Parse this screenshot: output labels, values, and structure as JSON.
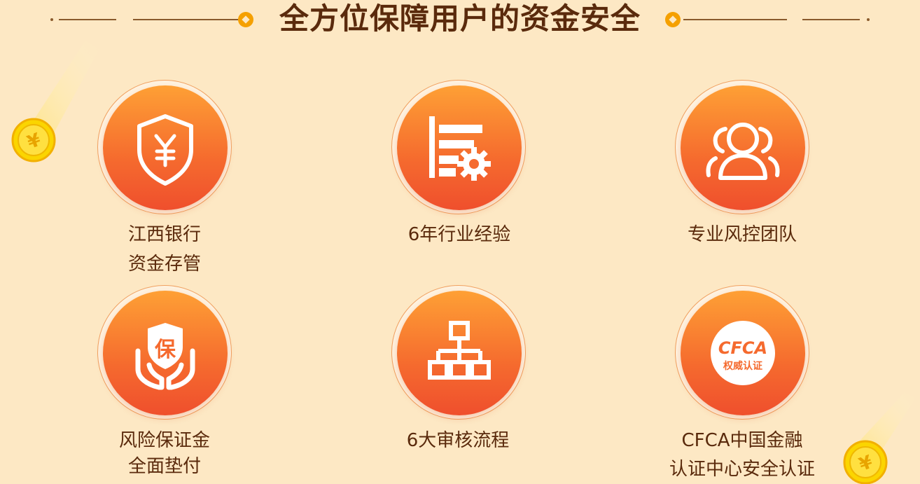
{
  "header": {
    "title": "全方位保障用户的资金安全"
  },
  "features": [
    {
      "line1": "江西银行",
      "line2": "资金存管",
      "icon": "shield-yen-icon"
    },
    {
      "line1": "6年行业经验",
      "line2": "",
      "icon": "server-gear-icon"
    },
    {
      "line1": "专业风控团队",
      "line2": "",
      "icon": "team-icon"
    },
    {
      "line1": "风险保证金",
      "line2": "全面垫付",
      "icon": "hands-protect-icon",
      "badge": "保"
    },
    {
      "line1": "6大审核流程",
      "line2": "",
      "icon": "org-chart-icon"
    },
    {
      "line1": "CFCA中国金融",
      "line2": "认证中心安全认证",
      "icon": "cfca-badge-icon",
      "badge_top": "CFCA",
      "badge_bottom": "权威认证"
    }
  ],
  "colors": {
    "background": "#fde8c4",
    "accent": "#f56a2e",
    "title": "#5a2a0c",
    "coin": "#f5c400"
  }
}
